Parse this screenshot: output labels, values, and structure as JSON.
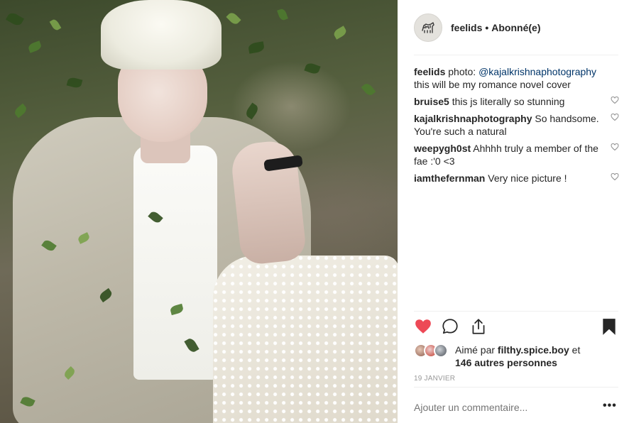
{
  "post": {
    "image_alt": "",
    "colors": {
      "heart_liked": "#ed4956",
      "link": "#003569",
      "muted": "#999999",
      "text": "#262626"
    }
  },
  "header": {
    "avatar_icon": "zebra-icon",
    "username": "feelids",
    "separator": "•",
    "follow_status": "Abonné(e)"
  },
  "caption": {
    "username": "feelids",
    "text_before": "photo: ",
    "mention": "@kajalkrishnaphotography",
    "text_after": " this will be my romance novel cover"
  },
  "comments": [
    {
      "username": "bruise5",
      "text": "this js literally so stunning"
    },
    {
      "username": "kajalkrishnaphotography",
      "text": "So handsome. You're such a natural"
    },
    {
      "username": "weepygh0st",
      "text": "Ahhhh truly a member of the fae :'0 <3"
    },
    {
      "username": "iamthefernman",
      "text": "Very nice picture !"
    }
  ],
  "actions": {
    "like_icon": "heart-filled-icon",
    "comment_icon": "comment-bubble-icon",
    "share_icon": "share-icon",
    "save_icon": "bookmark-icon"
  },
  "likes": {
    "prefix": "Aimé par ",
    "liked_by": "filthy.spice.boy",
    "conjunction": " et",
    "others": "146 autres personnes"
  },
  "date": "19 JANVIER",
  "add_comment": {
    "placeholder": "Ajouter un commentaire..."
  },
  "more_label": "•••"
}
